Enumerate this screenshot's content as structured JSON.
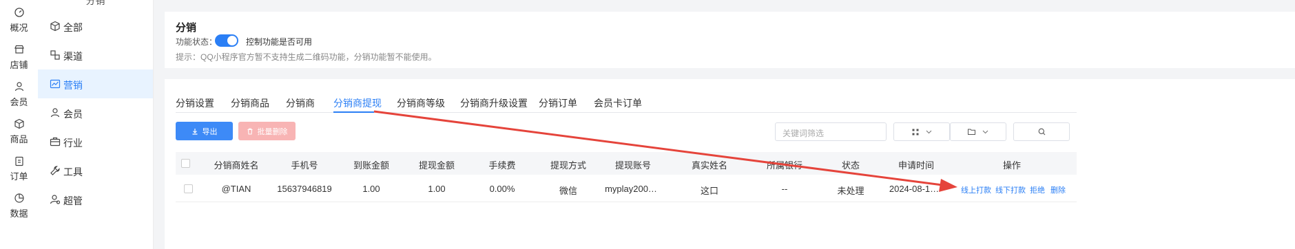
{
  "rail": {
    "items": [
      {
        "label": "概况",
        "icon": "dashboard-icon"
      },
      {
        "label": "店铺",
        "icon": "store-icon"
      },
      {
        "label": "会员",
        "icon": "user-icon"
      },
      {
        "label": "商品",
        "icon": "box-icon"
      },
      {
        "label": "订单",
        "icon": "clipboard-icon"
      },
      {
        "label": "数据",
        "icon": "pie-chart-icon"
      }
    ]
  },
  "menu": {
    "header": "分销",
    "items": [
      {
        "label": "全部",
        "icon": "cube-icon"
      },
      {
        "label": "渠道",
        "icon": "channel-icon"
      },
      {
        "label": "营销",
        "icon": "trend-icon"
      },
      {
        "label": "会员",
        "icon": "user-icon"
      },
      {
        "label": "行业",
        "icon": "briefcase-icon"
      },
      {
        "label": "工具",
        "icon": "wrench-icon"
      },
      {
        "label": "超管",
        "icon": "admin-icon"
      }
    ],
    "active_index": 2
  },
  "section": {
    "title": "分销",
    "status_label": "功能状态：",
    "toggle_on": true,
    "toggle_desc": "控制功能是否可用",
    "hint": "提示：QQ小程序官方暂不支持生成二维码功能，分销功能暂不能使用。"
  },
  "tabs": [
    "分销设置",
    "分销商品",
    "分销商",
    "分销商提现",
    "分销商等级",
    "分销商升级设置",
    "分销订单",
    "会员卡订单"
  ],
  "active_tab": 3,
  "toolbar": {
    "export_label": "导出",
    "batch_delete_label": "批量删除",
    "search_placeholder": "关键词筛选"
  },
  "table": {
    "columns": [
      "分销商姓名",
      "手机号",
      "到账金额",
      "提现金额",
      "手续费",
      "提现方式",
      "提现账号",
      "真实姓名",
      "所属银行",
      "状态",
      "申请时间",
      "操作"
    ],
    "rows": [
      {
        "name": "@TIAN",
        "phone": "15637946819",
        "received": "1.00",
        "amount": "1.00",
        "fee": "0.00%",
        "method": "微信",
        "account": "myplay200…",
        "real_name": "这口",
        "bank": "--",
        "status": "未处理",
        "time": "2024-08-1…",
        "actions": [
          "线上打款",
          "线下打款",
          "拒绝",
          "删除"
        ]
      }
    ]
  },
  "colors": {
    "accent": "#2b7ff5",
    "arrow": "#e5443b",
    "danger_disabled": "#f8b4b4"
  }
}
